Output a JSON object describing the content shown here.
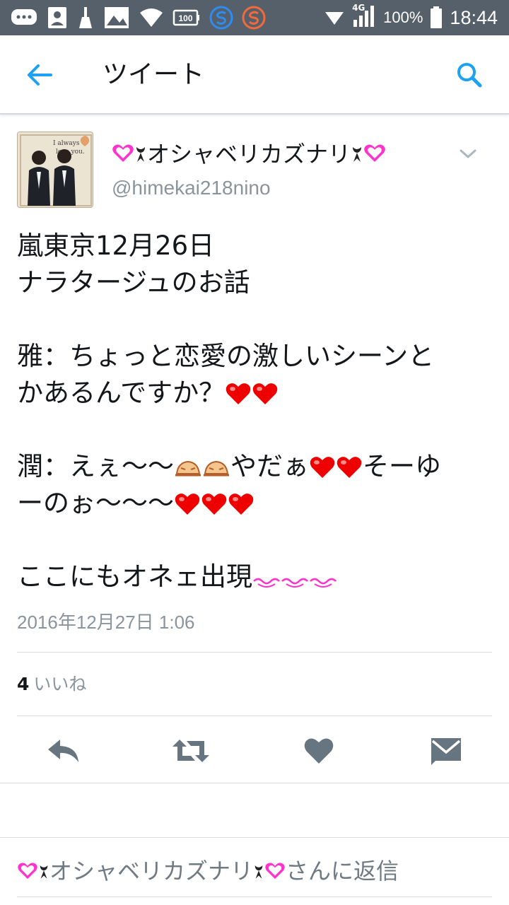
{
  "status_bar": {
    "network": "4G",
    "battery": "100%",
    "time": "18:44",
    "battery_icon_label": "100"
  },
  "header": {
    "title": "ツイート",
    "back_icon": "arrow-left-icon",
    "search_icon": "search-icon"
  },
  "tweet": {
    "display_name": "オシャベリカズナリ",
    "handle": "@himekai218nino",
    "lines": {
      "l1": "嵐東京12月26日",
      "l2": "ナラタージュのお話",
      "l3": "雅：ちょっと恋愛の激しいシーンと",
      "l4": "かあるんですか？",
      "l5a": "潤：えぇ〜〜",
      "l5b": "やだぁ",
      "l5c": "そーゆ",
      "l6": "ーのぉ〜〜〜",
      "l7": "ここにもオネェ出現"
    },
    "timestamp": "2016年12月27日 1:06",
    "likes_count": "4",
    "likes_label": "いいね"
  },
  "avatar": {
    "caption_1": "I always",
    "caption_2": "love you."
  },
  "actions": [
    "reply-icon",
    "retweet-icon",
    "like-icon",
    "direct-message-icon"
  ],
  "reply_box": {
    "name": "オシャベリカズナリ",
    "suffix": "さんに返信"
  },
  "colors": {
    "status_bar": "#56606b",
    "accent": "#1da1f2",
    "heart": "#ee0000",
    "pink_heart": "#ff33cc",
    "action_icon": "#66757f",
    "secondary_text": "#8a949c"
  }
}
